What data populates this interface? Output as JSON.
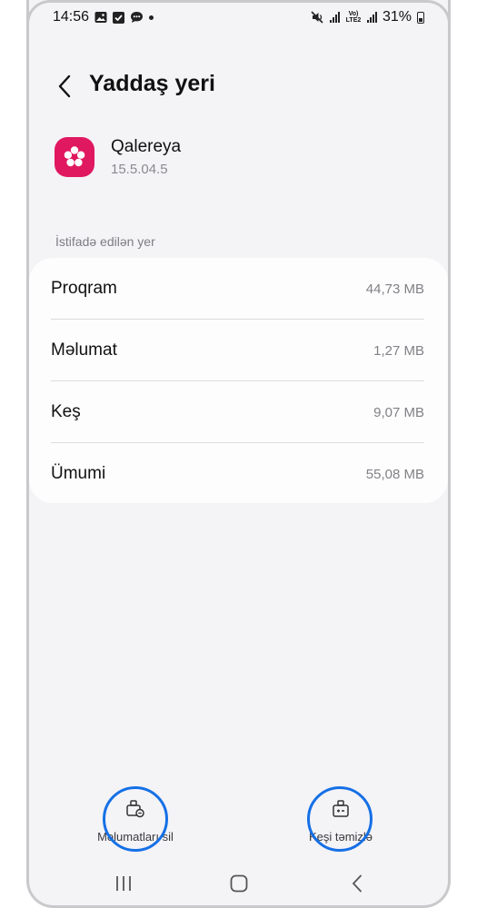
{
  "status_bar": {
    "time": "14:56",
    "battery_text": "31%",
    "network_label": "Vo) LTE2",
    "icons": [
      "gallery-icon",
      "check-box-icon",
      "chat-icon",
      "dot-icon",
      "mute-icon",
      "signal-icon",
      "battery-icon"
    ]
  },
  "header": {
    "title": "Yaddaş yeri",
    "back_icon": "chevron-left-icon"
  },
  "app": {
    "name": "Qalereya",
    "version": "15.5.04.5",
    "icon": "gallery-flower-icon",
    "icon_color": "#e0185f"
  },
  "storage": {
    "section_label": "İstifadə edilən yer",
    "rows": [
      {
        "label": "Proqram",
        "value": "44,73 MB"
      },
      {
        "label": "Məlumat",
        "value": "1,27 MB"
      },
      {
        "label": "Keş",
        "value": "9,07 MB"
      },
      {
        "label": "Ümumi",
        "value": "55,08 MB"
      }
    ]
  },
  "actions": {
    "clear_data": {
      "label": "Məlumatları sil",
      "icon": "clear-data-icon"
    },
    "clear_cache": {
      "label": "Keşi təmizlə",
      "icon": "clear-cache-icon"
    },
    "highlight_color": "#1570e6"
  },
  "nav_bar": {
    "icons": [
      "recents-icon",
      "home-icon",
      "back-icon"
    ]
  }
}
